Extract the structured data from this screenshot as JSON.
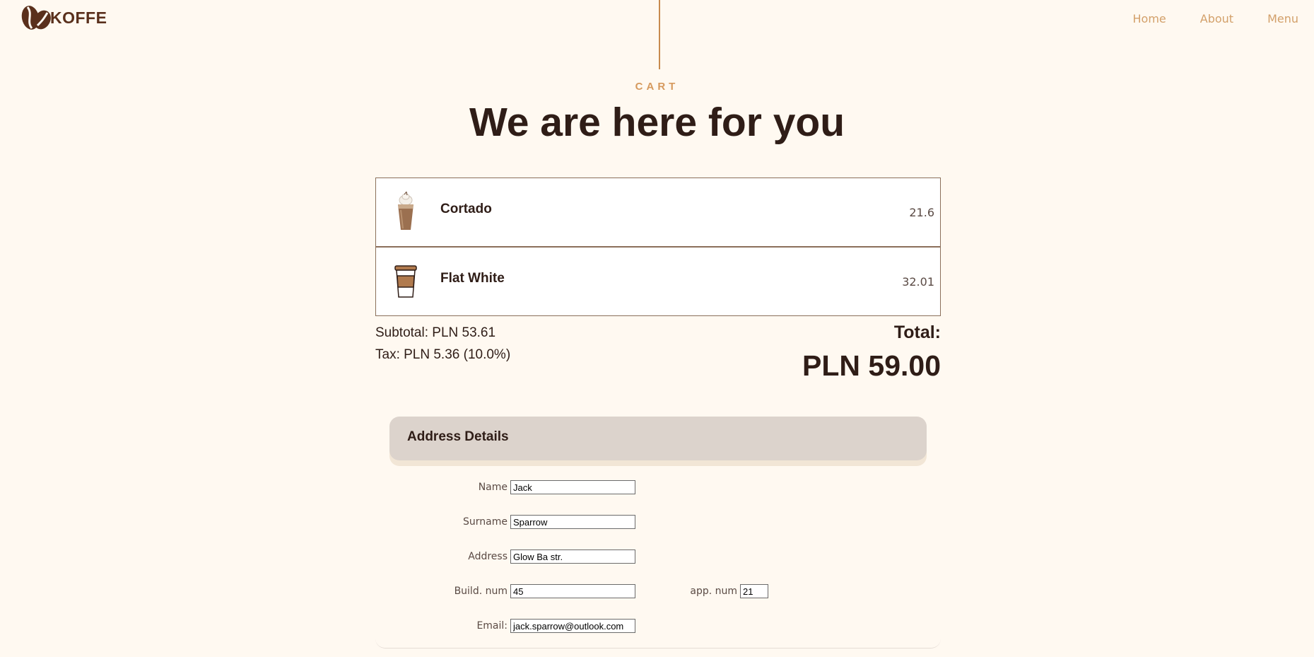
{
  "header": {
    "logo_text": "KOFFE",
    "nav": [
      "Home",
      "About",
      "Menu"
    ]
  },
  "hero": {
    "eyebrow": "CART",
    "title": "We are here for you"
  },
  "cart": {
    "items": [
      {
        "name": "Cortado",
        "price": "21.6",
        "icon": "iced-coffee-icon"
      },
      {
        "name": "Flat White",
        "price": "32.01",
        "icon": "takeaway-cup-icon"
      }
    ],
    "subtotal": "Subtotal: PLN 53.61",
    "tax": "Tax: PLN 5.36 (10.0%)",
    "total_label": "Total:",
    "total_value": "PLN 59.00"
  },
  "address": {
    "title": "Address Details",
    "fields": {
      "name": {
        "label": "Name",
        "value": "Jack"
      },
      "surname": {
        "label": "Surname",
        "value": "Sparrow"
      },
      "address": {
        "label": "Address",
        "value": "Glow Ba str."
      },
      "build": {
        "label": "Build. num",
        "value": "45"
      },
      "app": {
        "label": "app. num",
        "value": "21"
      },
      "email": {
        "label": "Email:",
        "value": "jack.sparrow@outlook.com"
      }
    }
  },
  "colors": {
    "background": "#fff9f1",
    "accent": "#d69a5e",
    "dark": "#2f1d17",
    "brand": "#5a301c"
  }
}
